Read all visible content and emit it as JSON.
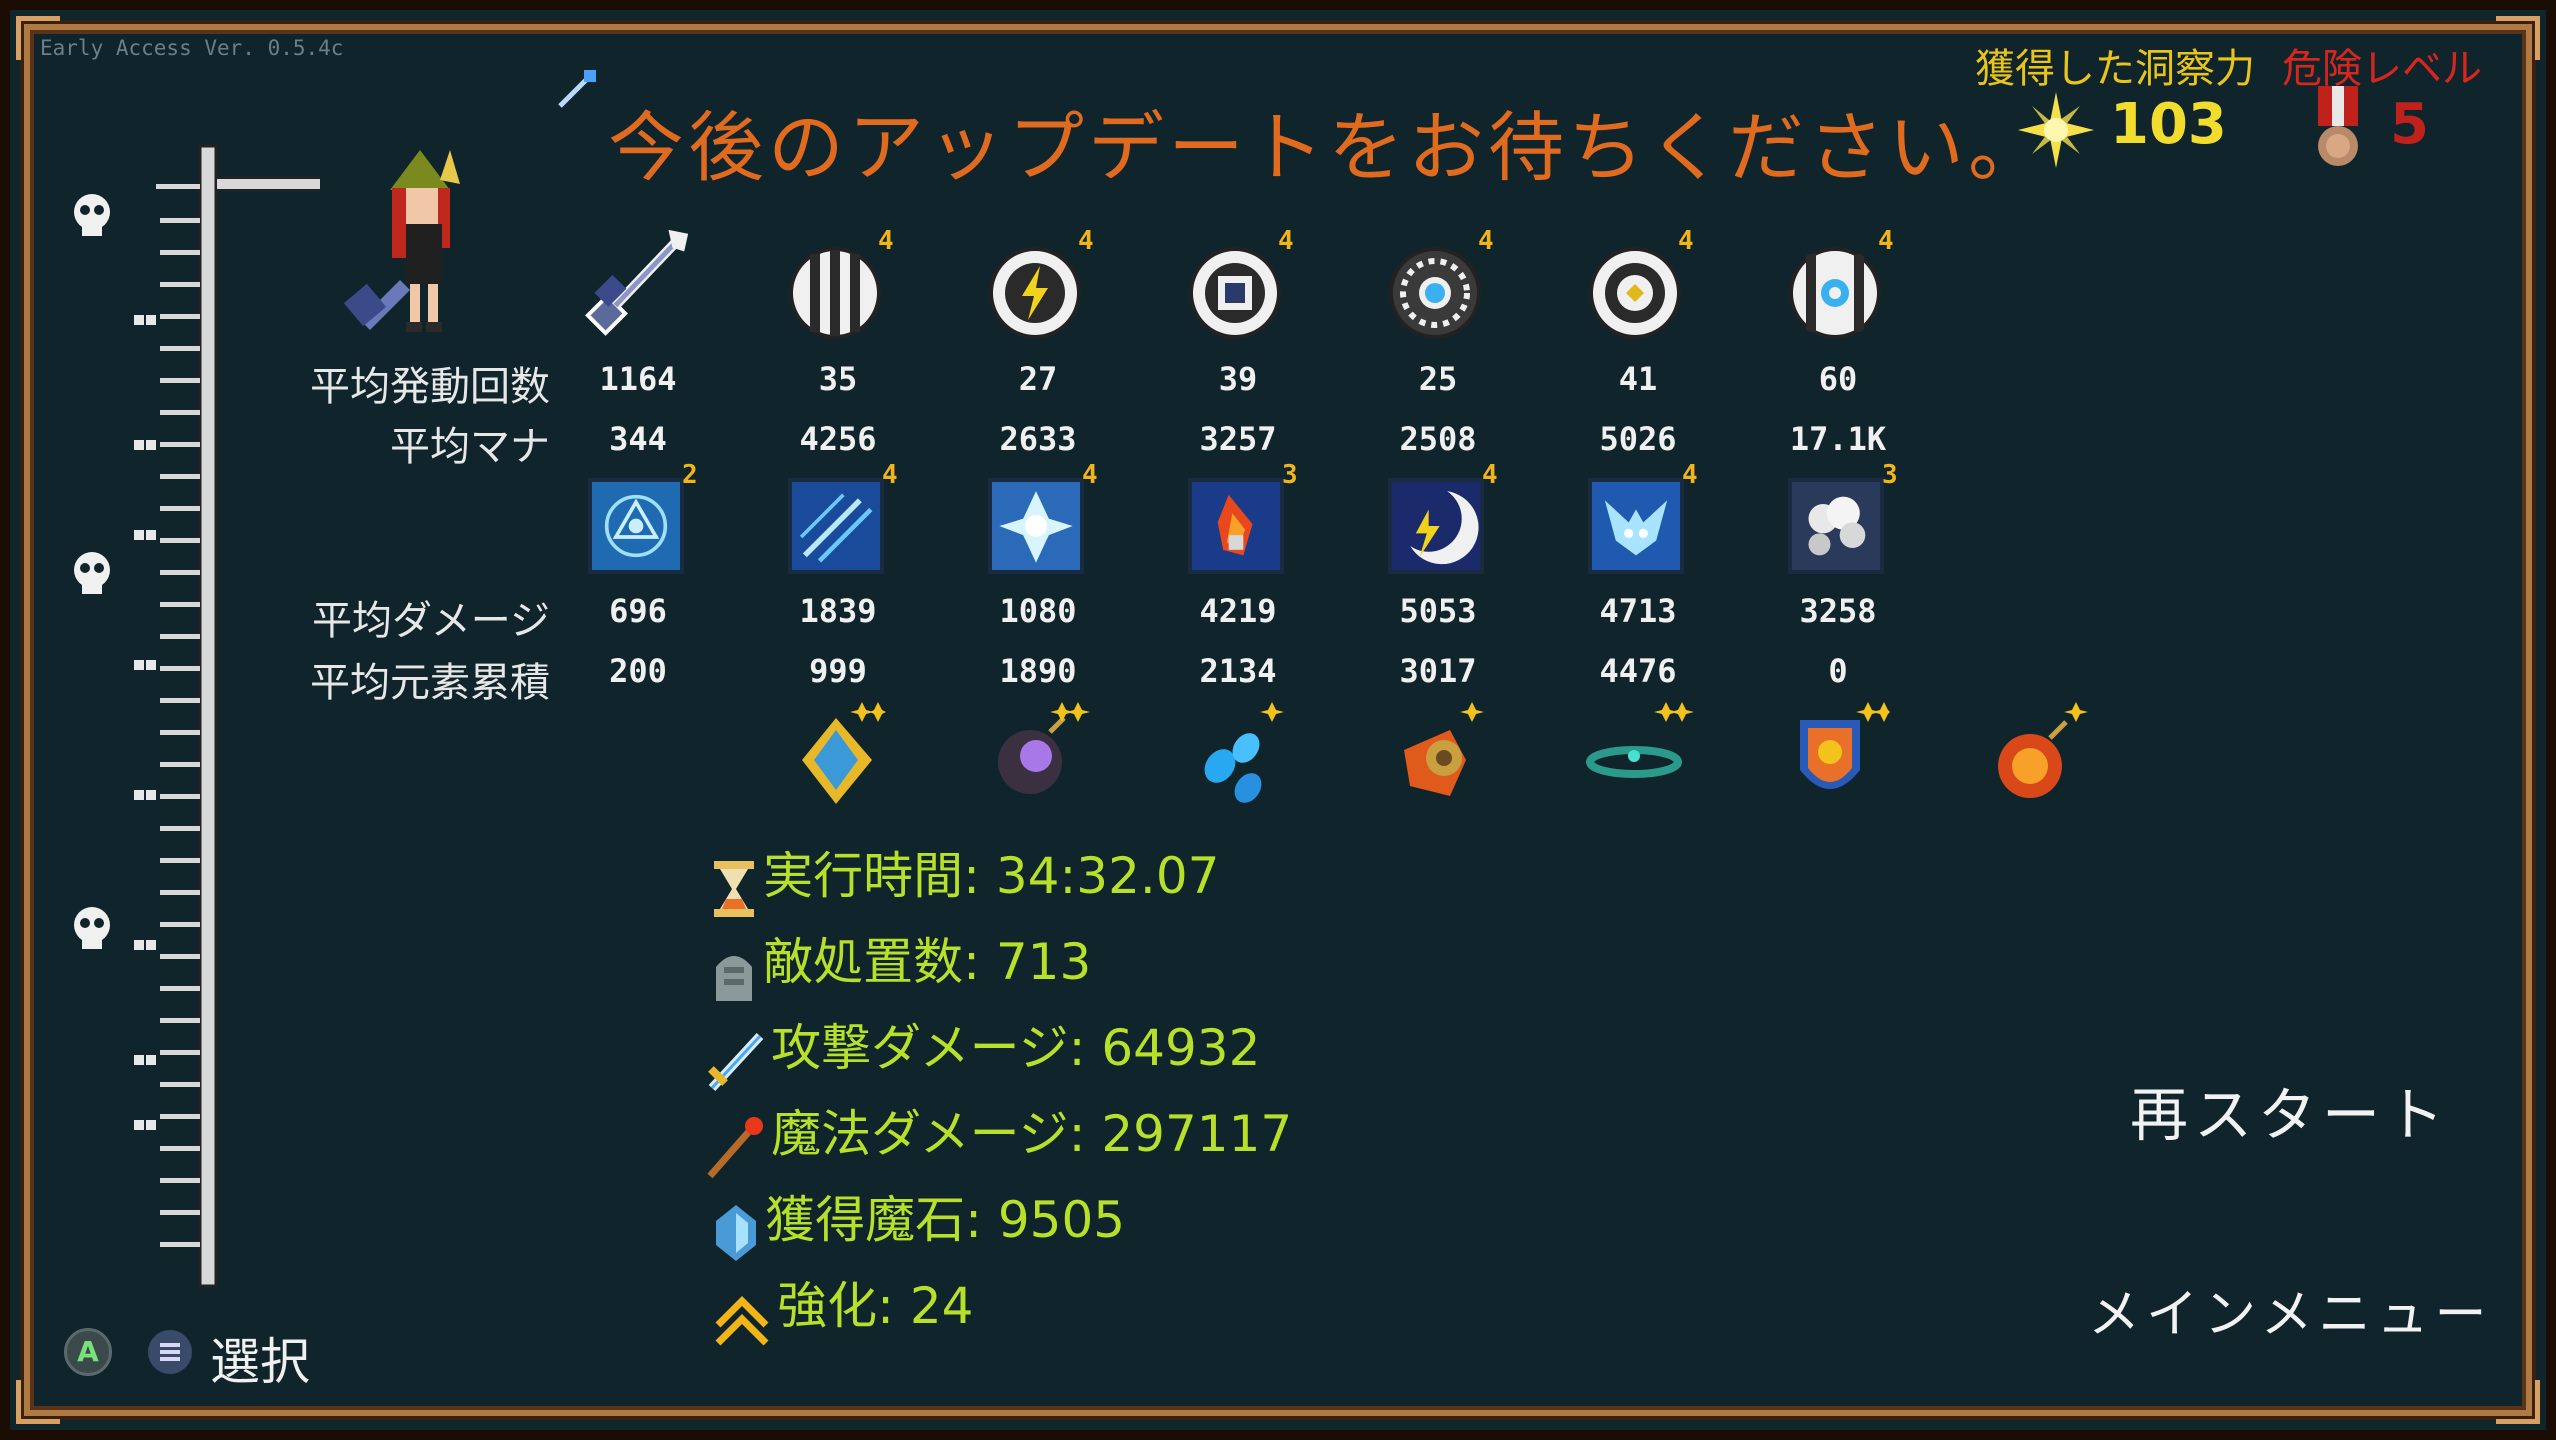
{
  "version": "Early Access Ver. 0.5.4c",
  "title": "今後のアップデートをお待ちください。",
  "insight": {
    "label": "獲得した洞察力",
    "value": "103",
    "icon": "sun-star-icon"
  },
  "danger": {
    "label": "危険レベル",
    "value": "5",
    "icon": "medal-icon"
  },
  "labels": {
    "avg_activations": "平均発動回数",
    "avg_mana": "平均マナ",
    "avg_damage": "平均ダメージ",
    "avg_element": "平均元素累積"
  },
  "wands": [
    {
      "icon": "wand-icon",
      "activations": "1164",
      "mana": "344",
      "level": ""
    },
    {
      "icon": "striped-orb-icon",
      "activations": "35",
      "mana": "4256",
      "level": "4"
    },
    {
      "icon": "lightning-orb-icon",
      "activations": "27",
      "mana": "2633",
      "level": "4"
    },
    {
      "icon": "square-orb-icon",
      "activations": "39",
      "mana": "3257",
      "level": "4"
    },
    {
      "icon": "snowflake-ring-orb-icon",
      "activations": "25",
      "mana": "2508",
      "level": "4"
    },
    {
      "icon": "diamond-orb-icon",
      "activations": "41",
      "mana": "5026",
      "level": "4"
    },
    {
      "icon": "snowflake-orb-icon",
      "activations": "60",
      "mana": "17.1K",
      "level": "4"
    }
  ],
  "skills": [
    {
      "icon": "magic-circle-skill-icon",
      "damage": "696",
      "element": "200",
      "level": "2"
    },
    {
      "icon": "ice-streak-skill-icon",
      "damage": "1839",
      "element": "999",
      "level": "4"
    },
    {
      "icon": "ice-burst-skill-icon",
      "damage": "1080",
      "element": "1890",
      "level": "4"
    },
    {
      "icon": "fire-bolt-skill-icon",
      "damage": "4219",
      "element": "2134",
      "level": "3"
    },
    {
      "icon": "lightning-moon-skill-icon",
      "damage": "5053",
      "element": "3017",
      "level": "4"
    },
    {
      "icon": "ice-fox-skill-icon",
      "damage": "4713",
      "element": "4476",
      "level": "4"
    },
    {
      "icon": "cloud-skill-icon",
      "damage": "3258",
      "element": "0",
      "level": "3"
    }
  ],
  "relics": [
    {
      "icon": "crystal-pendant-icon"
    },
    {
      "icon": "purple-bomb-icon"
    },
    {
      "icon": "blue-drops-icon"
    },
    {
      "icon": "fire-gauntlet-icon"
    },
    {
      "icon": "teal-ring-icon"
    },
    {
      "icon": "lion-shield-icon"
    },
    {
      "icon": "fire-bomb-icon"
    }
  ],
  "stats": [
    {
      "icon": "hourglass-icon",
      "text": "実行時間: 34:32.07"
    },
    {
      "icon": "tombstone-icon",
      "text": "敵処置数: 713"
    },
    {
      "icon": "sword-icon",
      "text": "攻撃ダメージ: 64932"
    },
    {
      "icon": "staff-icon",
      "text": "魔法ダメージ: 297117"
    },
    {
      "icon": "crystal-icon",
      "text": "獲得魔石: 9505"
    },
    {
      "icon": "chevron-up-icon",
      "text": "強化: 24"
    }
  ],
  "menu": {
    "restart": "再スタート",
    "main_menu": "メインメニュー"
  },
  "footer": {
    "button_a": "A",
    "select": "選択"
  },
  "colors": {
    "background": "#0f242b",
    "title": "#e06a1e",
    "stat_text": "#b6e02a",
    "insight": "#f2dc2e",
    "danger": "#c0221b",
    "level_badge": "#f3b418"
  }
}
